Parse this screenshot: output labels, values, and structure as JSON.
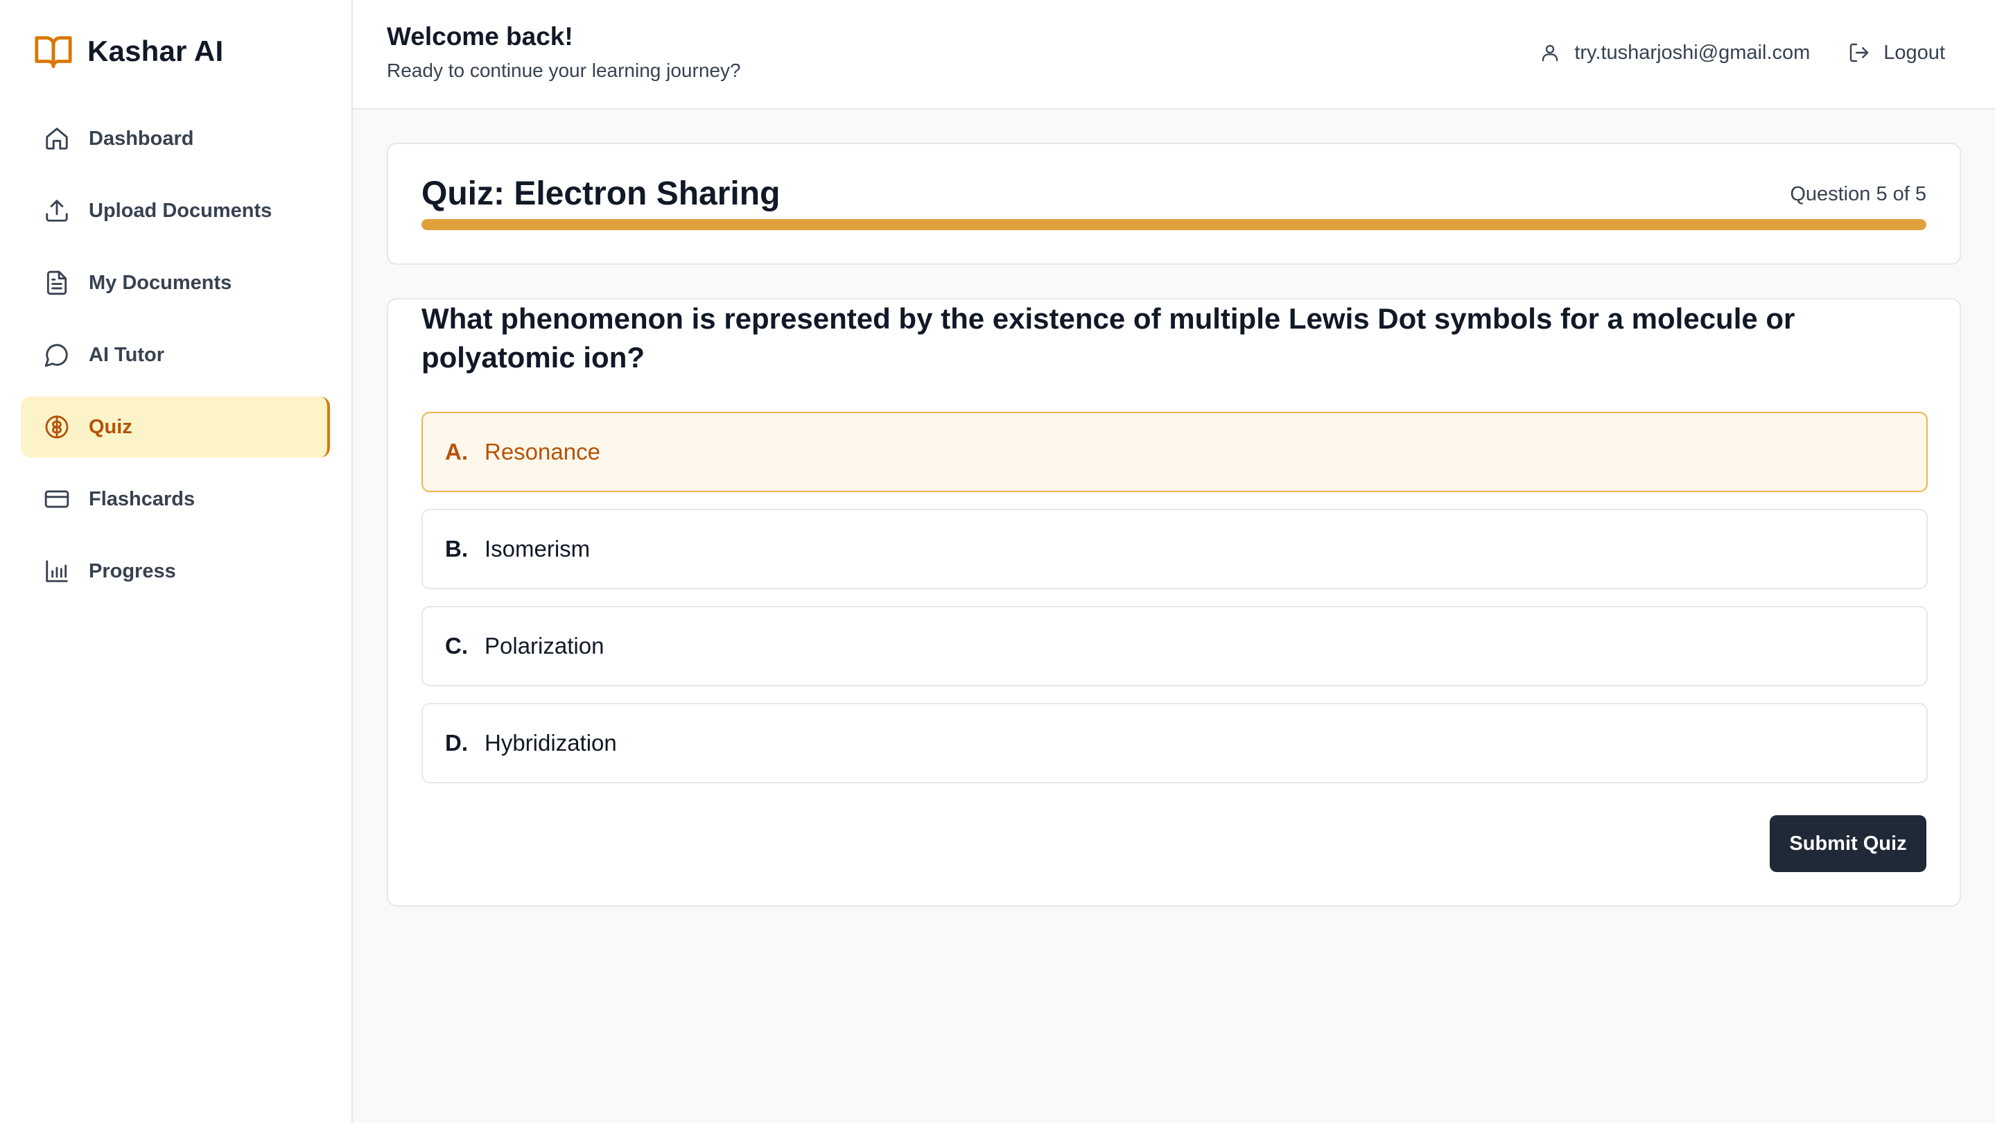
{
  "brand": {
    "name": "Kashar AI",
    "icon": "open-book-icon"
  },
  "sidebar": {
    "items": [
      {
        "label": "Dashboard",
        "icon": "home-icon",
        "active": false
      },
      {
        "label": "Upload Documents",
        "icon": "upload-icon",
        "active": false
      },
      {
        "label": "My Documents",
        "icon": "document-icon",
        "active": false
      },
      {
        "label": "AI Tutor",
        "icon": "chat-bubble-icon",
        "active": false
      },
      {
        "label": "Quiz",
        "icon": "brain-icon",
        "active": true
      },
      {
        "label": "Flashcards",
        "icon": "card-icon",
        "active": false
      },
      {
        "label": "Progress",
        "icon": "bar-chart-icon",
        "active": false
      }
    ]
  },
  "header": {
    "title": "Welcome back!",
    "subtitle": "Ready to continue your learning journey?",
    "user_email": "try.tusharjoshi@gmail.com",
    "logout_label": "Logout"
  },
  "quiz": {
    "title": "Quiz: Electron Sharing",
    "counter": "Question 5 of 5",
    "progress": 1.0,
    "question": "What phenomenon is represented by the existence of multiple Lewis Dot symbols for a molecule or polyatomic ion?",
    "options": [
      {
        "letter": "A.",
        "text": "Resonance",
        "selected": true
      },
      {
        "letter": "B.",
        "text": "Isomerism",
        "selected": false
      },
      {
        "letter": "C.",
        "text": "Polarization",
        "selected": false
      },
      {
        "letter": "D.",
        "text": "Hybridization",
        "selected": false
      }
    ],
    "submit_label": "Submit Quiz"
  },
  "colors": {
    "accent": "#d97706",
    "accent_text": "#b45309",
    "active_bg": "#fdf3c8",
    "progress_fill": "#e0a13c",
    "button_bg": "#1f2937"
  }
}
